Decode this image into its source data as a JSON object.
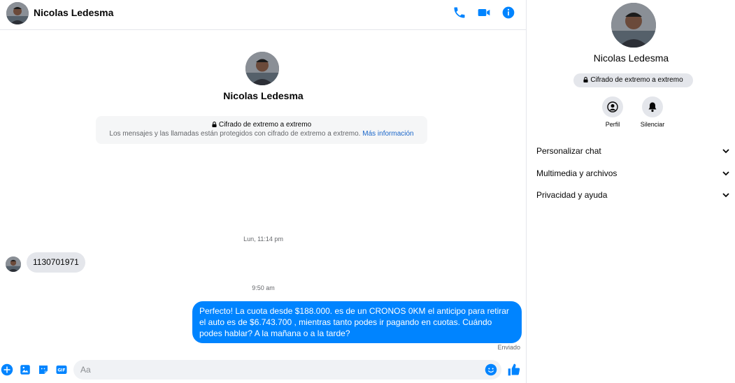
{
  "contact": {
    "name": "Nicolas Ledesma"
  },
  "header": {
    "name": "Nicolas Ledesma"
  },
  "intro": {
    "name": "Nicolas Ledesma",
    "encryption_title": "Cifrado de extremo a extremo",
    "encryption_desc": "Los mensajes y las llamadas están protegidos con cifrado de extremo a extremo.",
    "encryption_link": "Más información"
  },
  "conversation": {
    "timestamp_1": "Lun, 11:14 pm",
    "incoming_message": "1130701971",
    "timestamp_2": "9:50 am",
    "outgoing_message": "Perfecto! La cuota desde $188.000. es de un CRONOS 0KM el anticipo para retirar el auto es de $6.743.700 , mientras tanto podes ir pagando en cuotas. Cuándo podes hablar? A la mañana o a la tarde?",
    "sent_status": "Enviado"
  },
  "composer": {
    "placeholder": "Aa"
  },
  "sidebar": {
    "name": "Nicolas Ledesma",
    "encryption_pill": "Cifrado de extremo a extremo",
    "actions": [
      {
        "label": "Perfil",
        "icon": "profile-icon"
      },
      {
        "label": "Silenciar",
        "icon": "bell-icon"
      }
    ],
    "sections": [
      {
        "label": "Personalizar chat"
      },
      {
        "label": "Multimedia y archivos"
      },
      {
        "label": "Privacidad y ayuda"
      }
    ]
  },
  "colors": {
    "accent": "#0084ff",
    "incoming_bubble": "#e4e6eb",
    "link": "#1a66c9"
  }
}
